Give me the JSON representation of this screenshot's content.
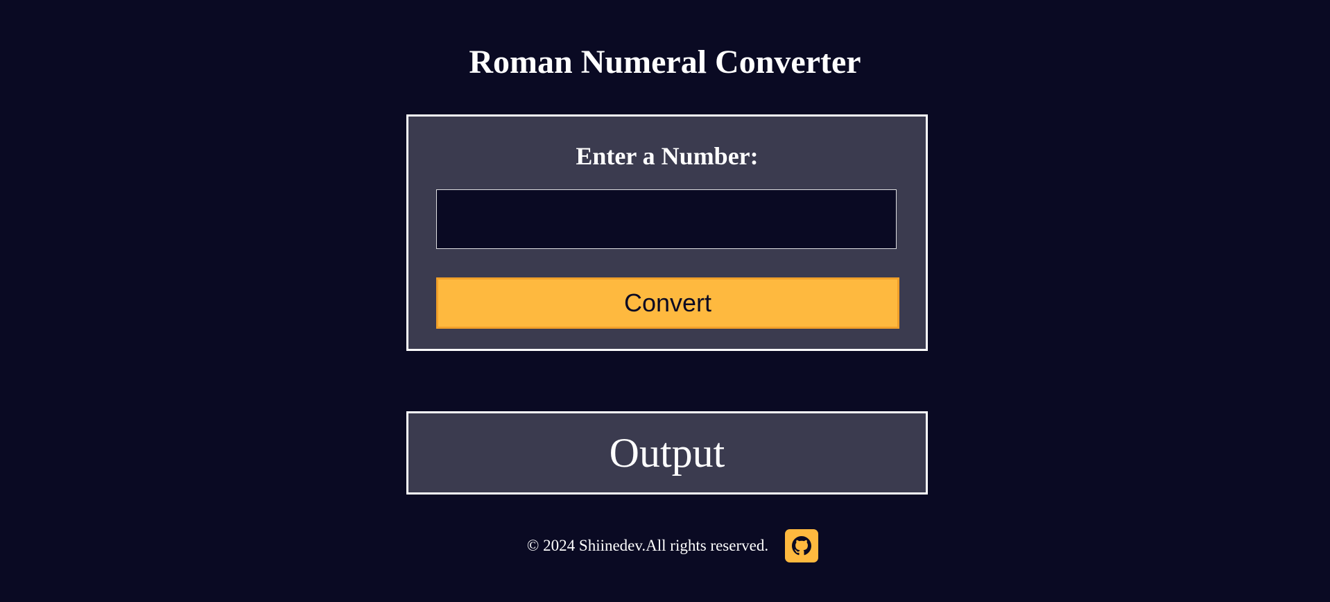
{
  "header": {
    "title": "Roman Numeral Converter"
  },
  "form": {
    "label": "Enter a Number:",
    "input_value": "",
    "input_placeholder": "",
    "convert_label": "Convert"
  },
  "output": {
    "text": "Output"
  },
  "footer": {
    "copyright": "© 2024 Shiinedev.All rights reserved.",
    "github_icon": "github-icon"
  },
  "colors": {
    "background": "#0a0a23",
    "card": "#3b3b4f",
    "accent": "#feb93f",
    "text": "#ffffff"
  }
}
